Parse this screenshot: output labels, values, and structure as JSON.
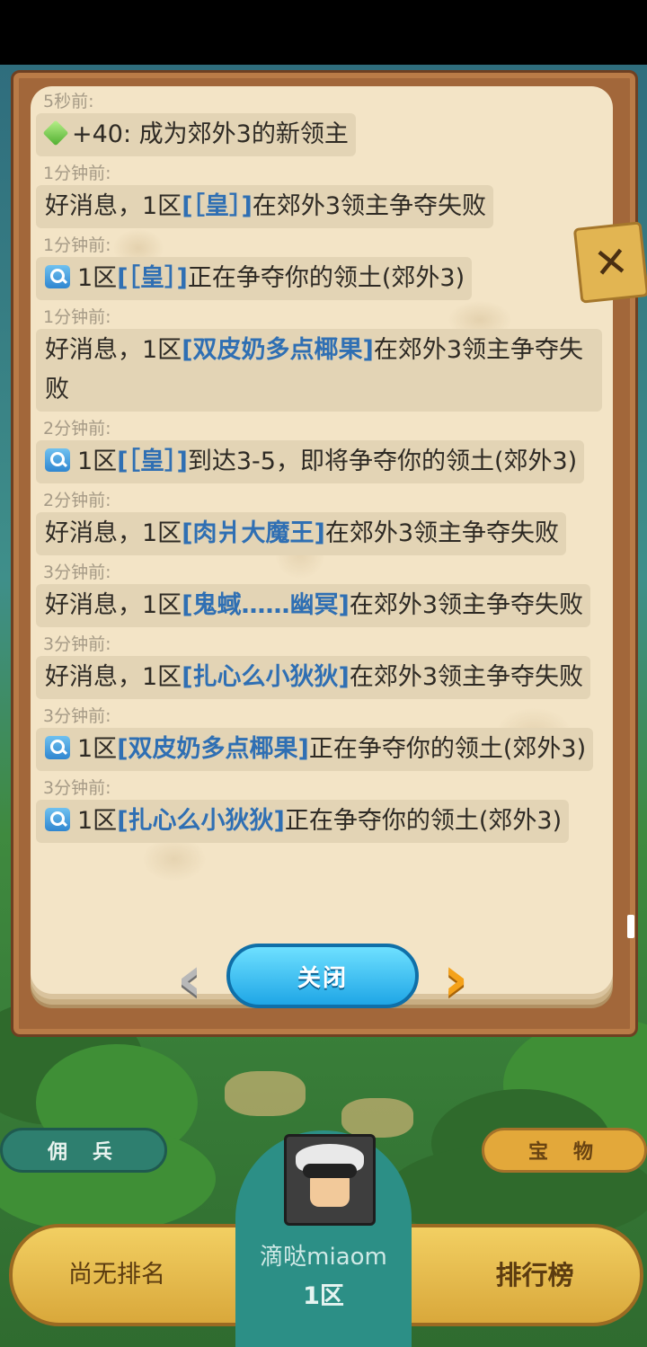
{
  "log": [
    {
      "time": "5秒前:",
      "icon": "gem-icon",
      "parts": [
        {
          "t": "+40: 成为郊外3的新领主"
        }
      ]
    },
    {
      "time": "1分钟前:",
      "icon": null,
      "parts": [
        {
          "t": "好消息，1区"
        },
        {
          "t": "[［皇］]",
          "name": true
        },
        {
          "t": "在郊外3领主争夺失败"
        }
      ]
    },
    {
      "time": "1分钟前:",
      "icon": "search-icon",
      "parts": [
        {
          "t": "1区"
        },
        {
          "t": "[［皇］]",
          "name": true
        },
        {
          "t": "正在争夺你的领土(郊外3)"
        }
      ]
    },
    {
      "time": "1分钟前:",
      "icon": null,
      "wrap": true,
      "parts": [
        {
          "t": "好消息，1区"
        },
        {
          "t": "[双皮奶多点椰果]",
          "name": true
        },
        {
          "t": "在郊外3领主争夺失败"
        }
      ]
    },
    {
      "time": "2分钟前:",
      "icon": "search-icon",
      "parts": [
        {
          "t": "1区"
        },
        {
          "t": "[［皇］]",
          "name": true
        },
        {
          "t": "到达3-5，即将争夺你的领土(郊外3)"
        }
      ]
    },
    {
      "time": "2分钟前:",
      "icon": null,
      "parts": [
        {
          "t": "好消息，1区"
        },
        {
          "t": "[肉爿大魔王]",
          "name": true
        },
        {
          "t": "在郊外3领主争夺失败"
        }
      ]
    },
    {
      "time": "3分钟前:",
      "icon": null,
      "parts": [
        {
          "t": "好消息，1区"
        },
        {
          "t": "[鬼蜮……幽冥]",
          "name": true
        },
        {
          "t": "在郊外3领主争夺失败"
        }
      ]
    },
    {
      "time": "3分钟前:",
      "icon": null,
      "parts": [
        {
          "t": "好消息，1区"
        },
        {
          "t": "[扎心么小狄狄]",
          "name": true
        },
        {
          "t": "在郊外3领主争夺失败"
        }
      ]
    },
    {
      "time": "3分钟前:",
      "icon": "search-icon",
      "parts": [
        {
          "t": "1区"
        },
        {
          "t": "[双皮奶多点椰果]",
          "name": true
        },
        {
          "t": "正在争夺你的领土(郊外3)"
        }
      ]
    },
    {
      "time": "3分钟前:",
      "icon": "search-icon",
      "parts": [
        {
          "t": "1区"
        },
        {
          "t": "[扎心么小狄狄]",
          "name": true
        },
        {
          "t": "正在争夺你的领土(郊外3)"
        }
      ]
    }
  ],
  "panel": {
    "close_label": "关闭",
    "close_x": "✕",
    "prev_arrow": "‹",
    "next_arrow": "›"
  },
  "side_buttons": {
    "mercenary": "佣兵",
    "treasure": "宝物"
  },
  "bottom_bar": {
    "rank_label": "尚无排名",
    "leaderboard_label": "排行榜",
    "player_name": "滴哒miaom",
    "player_zone": "1区"
  }
}
